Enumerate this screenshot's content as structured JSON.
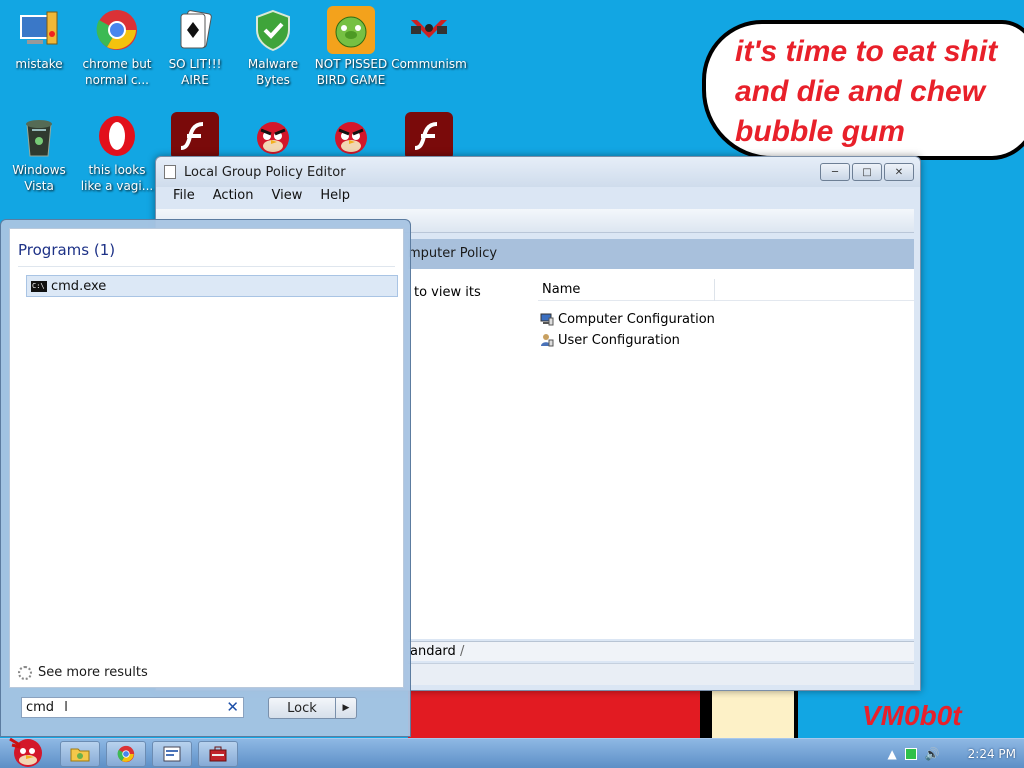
{
  "desktop": {
    "icons": [
      {
        "label": "mistake",
        "icon": "computer-icon"
      },
      {
        "label": "chrome but normal c...",
        "icon": "chrome-icon"
      },
      {
        "label": "SO LIT!!! AIRE",
        "icon": "solitaire-icon"
      },
      {
        "label": "Malware Bytes",
        "icon": "shield-check-icon"
      },
      {
        "label": "NOT PISSED BIRD GAME",
        "icon": "green-pig-icon"
      },
      {
        "label": "Communism",
        "icon": "emblem-icon"
      },
      {
        "label": "Windows Vista",
        "icon": "recycle-bin-icon"
      },
      {
        "label": "this looks like a vagi...",
        "icon": "opera-icon"
      },
      {
        "label": "",
        "icon": "flash-icon"
      },
      {
        "label": "",
        "icon": "angry-bird-icon"
      },
      {
        "label": "",
        "icon": "angry-bird-icon"
      },
      {
        "label": "",
        "icon": "flash-icon"
      }
    ],
    "bubble_text": "it's time to eat shit\nand die and chew\nbubble gum",
    "watermark": "VM0b0t"
  },
  "policy_window": {
    "title": "Local Group Policy Editor",
    "menu": [
      "File",
      "Action",
      "View",
      "Help"
    ],
    "header": "mputer Policy",
    "description": "to view its",
    "column_name": "Name",
    "rows": [
      {
        "label": "Computer Configuration",
        "icon": "computer-config-icon"
      },
      {
        "label": "User Configuration",
        "icon": "user-config-icon"
      }
    ],
    "tab": "andard"
  },
  "start_menu": {
    "programs_header": "Programs (1)",
    "result": "cmd.exe",
    "see_more": "See more results",
    "search_value": "cmd",
    "lock_label": "Lock"
  },
  "taskbar": {
    "clock": "2:24 PM"
  },
  "colors": {
    "desktop": "#12a6e3",
    "bubble_text": "#e8202a",
    "highlight": "#dce8f6"
  }
}
